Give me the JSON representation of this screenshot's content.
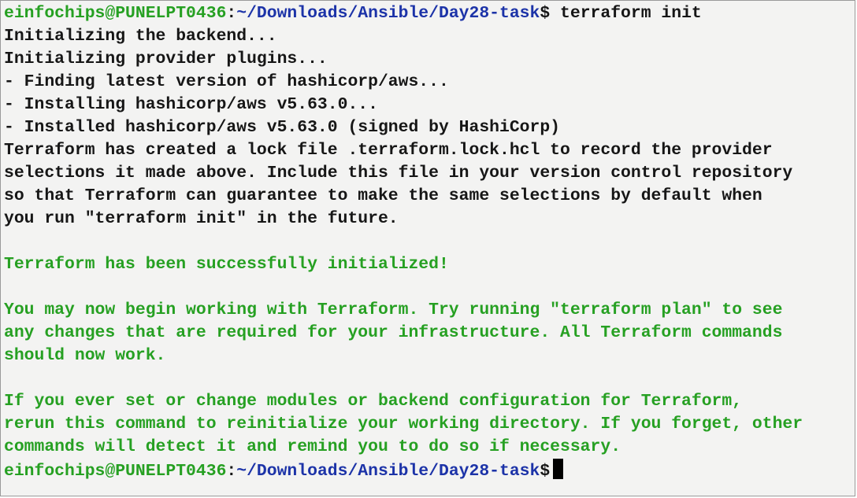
{
  "colors": {
    "background": "#f3f3f2",
    "text": "#161616",
    "prompt_user": "#26a022",
    "prompt_path": "#1c33a8",
    "success": "#26a022"
  },
  "prompt": {
    "user_host": "einfochips@PUNELPT0436",
    "separator": ":",
    "path": "~/Downloads/Ansible/Day28-task",
    "symbol": "$"
  },
  "command": " terraform init",
  "output": {
    "init_backend": "Initializing the backend...",
    "init_plugins": "Initializing provider plugins...",
    "finding": "- Finding latest version of hashicorp/aws...",
    "installing": "- Installing hashicorp/aws v5.63.0...",
    "installed": "- Installed hashicorp/aws v5.63.0 (signed by HashiCorp)",
    "lock_1": "Terraform has created a lock file .terraform.lock.hcl to record the provider",
    "lock_2": "selections it made above. Include this file in your version control repository",
    "lock_3": "so that Terraform can guarantee to make the same selections by default when",
    "lock_4": "you run \"terraform init\" in the future.",
    "success": "Terraform has been successfully initialized!",
    "next_1": "You may now begin working with Terraform. Try running \"terraform plan\" to see",
    "next_2": "any changes that are required for your infrastructure. All Terraform commands",
    "next_3": "should now work.",
    "rerun_1": "If you ever set or change modules or backend configuration for Terraform,",
    "rerun_2": "rerun this command to reinitialize your working directory. If you forget, other",
    "rerun_3": "commands will detect it and remind you to do so if necessary."
  }
}
